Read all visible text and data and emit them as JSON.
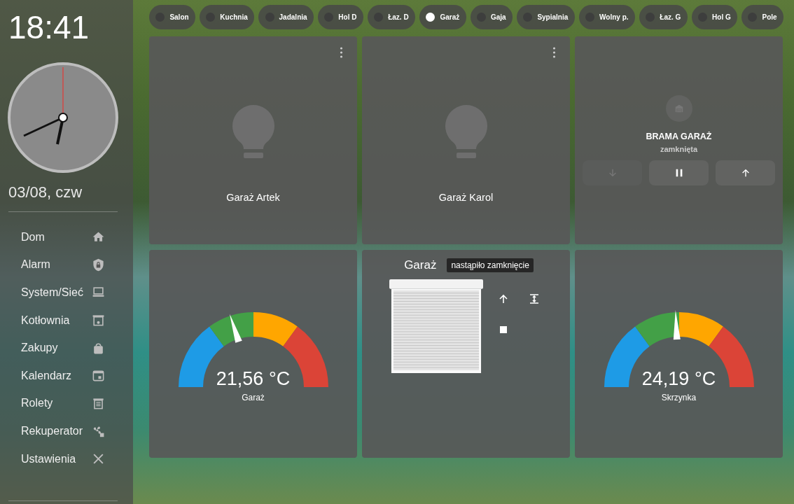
{
  "sidebar": {
    "time": "18:41",
    "date": "03/08, czw",
    "items": [
      {
        "label": "Dom"
      },
      {
        "label": "Alarm"
      },
      {
        "label": "System/Sieć"
      },
      {
        "label": "Kotłownia"
      },
      {
        "label": "Zakupy"
      },
      {
        "label": "Kalendarz"
      },
      {
        "label": "Rolety"
      },
      {
        "label": "Rekuperator"
      },
      {
        "label": "Ustawienia"
      }
    ]
  },
  "rooms": [
    {
      "label": "Salon",
      "selected": false
    },
    {
      "label": "Kuchnia",
      "selected": false
    },
    {
      "label": "Jadalnia",
      "selected": false
    },
    {
      "label": "Hol D",
      "selected": false
    },
    {
      "label": "Łaz. D",
      "selected": false
    },
    {
      "label": "Garaż",
      "selected": true
    },
    {
      "label": "Gaja",
      "selected": false
    },
    {
      "label": "Sypialnia",
      "selected": false
    },
    {
      "label": "Wolny p.",
      "selected": false
    },
    {
      "label": "Łaz. G",
      "selected": false
    },
    {
      "label": "Hol G",
      "selected": false
    },
    {
      "label": "Pole",
      "selected": false
    }
  ],
  "cards": [
    {
      "kind": "light",
      "name": "Garaż Artek"
    },
    {
      "kind": "light",
      "name": "Garaż Karol"
    },
    {
      "kind": "cover",
      "name": "BRAMA GARAŻ",
      "state": "zamknięta",
      "buttons": [
        {
          "kind": "down",
          "disabled": true
        },
        {
          "kind": "pause",
          "disabled": false
        },
        {
          "kind": "up",
          "disabled": false
        }
      ]
    },
    {
      "kind": "gauge",
      "value": "21,56 °C",
      "name": "Garaż",
      "level": 0.4
    },
    {
      "kind": "shutter",
      "name": "Garaż",
      "badge": "nastąpiło zamknięcie"
    },
    {
      "kind": "gauge",
      "value": "24,19 °C",
      "name": "Skrzynka",
      "level": 0.485
    }
  ]
}
